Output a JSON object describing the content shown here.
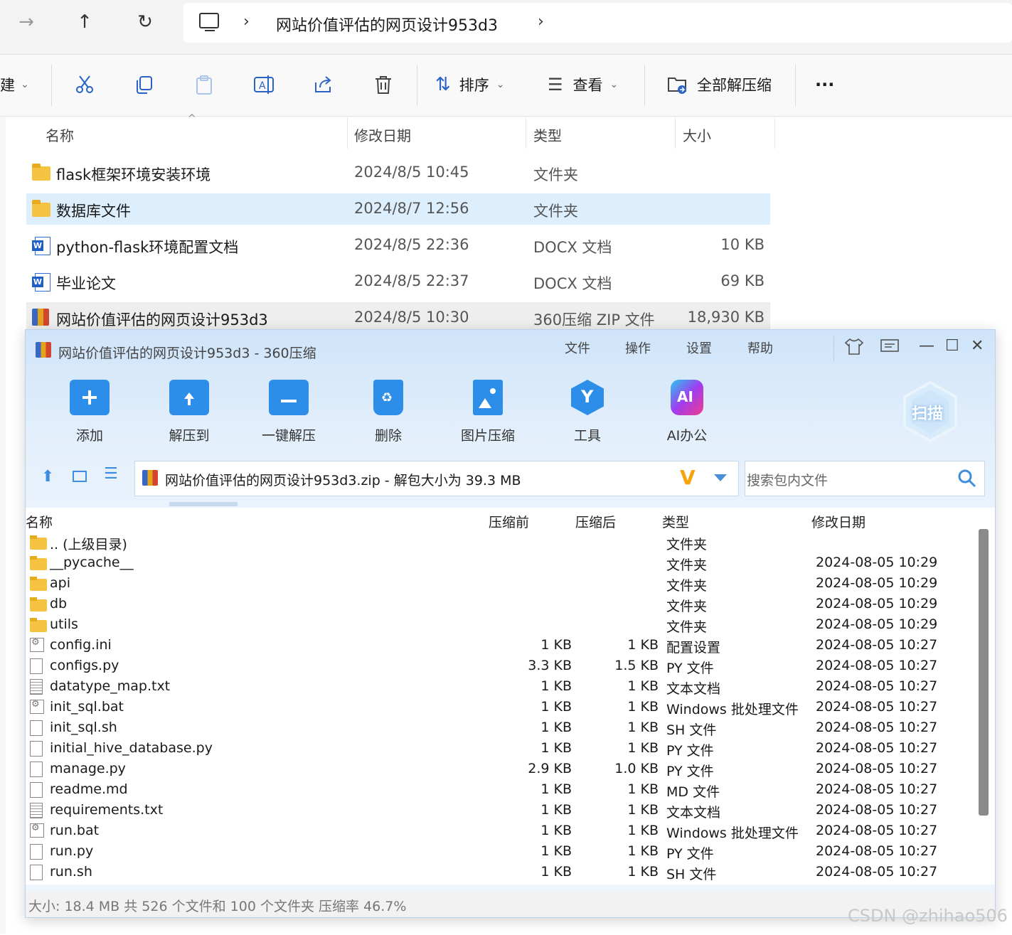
{
  "explorer": {
    "breadcrumb": "网站价值评估的网页设计953d3",
    "toolbar": {
      "new_label": "建",
      "sort_label": "排序",
      "view_label": "查看",
      "extract_all_label": "全部解压缩",
      "more_label": "···"
    },
    "columns": {
      "name": "名称",
      "date": "修改日期",
      "type": "类型",
      "size": "大小"
    },
    "files": [
      {
        "name": "flask框架环境安装环境",
        "date": "2024/8/5 10:45",
        "type": "文件夹",
        "size": "",
        "icon": "folder-icon"
      },
      {
        "name": "数据库文件",
        "date": "2024/8/7 12:56",
        "type": "文件夹",
        "size": "",
        "icon": "folder-icon"
      },
      {
        "name": "python-flask环境配置文档",
        "date": "2024/8/5 22:36",
        "type": "DOCX 文档",
        "size": "10 KB",
        "icon": "word-doc-icon"
      },
      {
        "name": "毕业论文",
        "date": "2024/8/5 22:37",
        "type": "DOCX 文档",
        "size": "69 KB",
        "icon": "word-doc-icon"
      },
      {
        "name": "网站价值评估的网页设计953d3",
        "date": "2024/8/5 10:30",
        "type": "360压缩 ZIP 文件",
        "size": "18,930 KB",
        "icon": "zip-archive-icon"
      }
    ]
  },
  "zipwin": {
    "title": "网站价值评估的网页设计953d3 - 360压缩",
    "menu": [
      "文件",
      "操作",
      "设置",
      "帮助"
    ],
    "buttons": [
      "添加",
      "解压到",
      "一键解压",
      "删除",
      "图片压缩",
      "工具",
      "AI办公"
    ],
    "scan_label": "扫描",
    "ai_badge": "AI",
    "path": "网站价值评估的网页设计953d3.zip - 解包大小为 39.3 MB",
    "search_placeholder": "搜索包内文件",
    "columns": {
      "name": "名称",
      "before": "压缩前",
      "after": "压缩后",
      "type": "类型",
      "date": "修改日期"
    },
    "rows": [
      {
        "name": ".. (上级目录)",
        "before": "",
        "after": "",
        "type": "文件夹",
        "date": "",
        "icon": "folder"
      },
      {
        "name": "__pycache__",
        "before": "",
        "after": "",
        "type": "文件夹",
        "date": "2024-08-05 10:29",
        "icon": "folder"
      },
      {
        "name": "api",
        "before": "",
        "after": "",
        "type": "文件夹",
        "date": "2024-08-05 10:29",
        "icon": "folder"
      },
      {
        "name": "db",
        "before": "",
        "after": "",
        "type": "文件夹",
        "date": "2024-08-05 10:29",
        "icon": "folder"
      },
      {
        "name": "utils",
        "before": "",
        "after": "",
        "type": "文件夹",
        "date": "2024-08-05 10:29",
        "icon": "folder"
      },
      {
        "name": "config.ini",
        "before": "1 KB",
        "after": "1 KB",
        "type": "配置设置",
        "date": "2024-08-05 10:27",
        "icon": "config"
      },
      {
        "name": "configs.py",
        "before": "3.3 KB",
        "after": "1.5 KB",
        "type": "PY 文件",
        "date": "2024-08-05 10:27",
        "icon": "file"
      },
      {
        "name": "datatype_map.txt",
        "before": "1 KB",
        "after": "1 KB",
        "type": "文本文档",
        "date": "2024-08-05 10:27",
        "icon": "text"
      },
      {
        "name": "init_sql.bat",
        "before": "1 KB",
        "after": "1 KB",
        "type": "Windows 批处理文件",
        "date": "2024-08-05 10:27",
        "icon": "config"
      },
      {
        "name": "init_sql.sh",
        "before": "1 KB",
        "after": "1 KB",
        "type": "SH 文件",
        "date": "2024-08-05 10:27",
        "icon": "file"
      },
      {
        "name": "initial_hive_database.py",
        "before": "1 KB",
        "after": "1 KB",
        "type": "PY 文件",
        "date": "2024-08-05 10:27",
        "icon": "file"
      },
      {
        "name": "manage.py",
        "before": "2.9 KB",
        "after": "1.0 KB",
        "type": "PY 文件",
        "date": "2024-08-05 10:27",
        "icon": "file"
      },
      {
        "name": "readme.md",
        "before": "1 KB",
        "after": "1 KB",
        "type": "MD 文件",
        "date": "2024-08-05 10:27",
        "icon": "file"
      },
      {
        "name": "requirements.txt",
        "before": "1 KB",
        "after": "1 KB",
        "type": "文本文档",
        "date": "2024-08-05 10:27",
        "icon": "text"
      },
      {
        "name": "run.bat",
        "before": "1 KB",
        "after": "1 KB",
        "type": "Windows 批处理文件",
        "date": "2024-08-05 10:27",
        "icon": "config"
      },
      {
        "name": "run.py",
        "before": "1 KB",
        "after": "1 KB",
        "type": "PY 文件",
        "date": "2024-08-05 10:27",
        "icon": "file"
      },
      {
        "name": "run.sh",
        "before": "1 KB",
        "after": "1 KB",
        "type": "SH 文件",
        "date": "2024-08-05 10:27",
        "icon": "file"
      }
    ],
    "status": "大小: 18.4 MB 共 526 个文件和 100 个文件夹 压缩率 46.7%"
  },
  "watermark": "CSDN @zhihao506"
}
